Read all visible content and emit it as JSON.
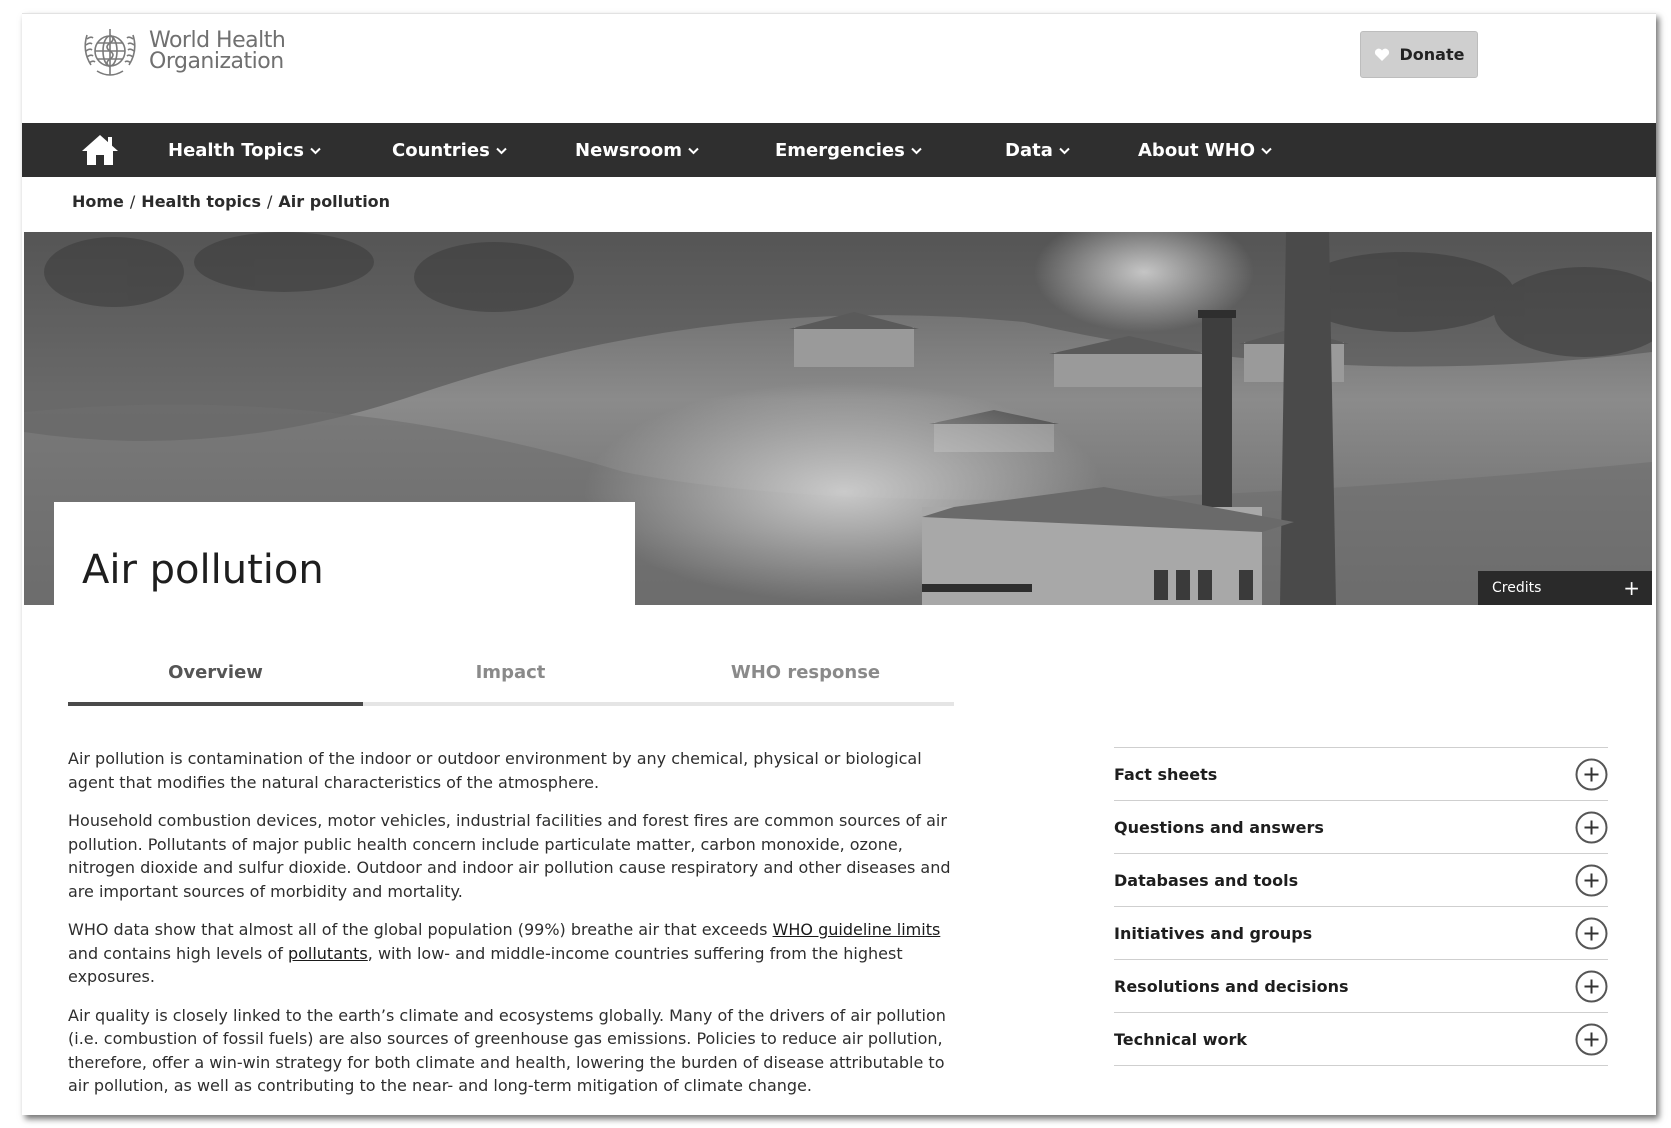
{
  "header": {
    "logo_line1": "World Health",
    "logo_line2": "Organization",
    "donate_label": "Donate"
  },
  "nav": {
    "items": [
      {
        "label": "Health Topics"
      },
      {
        "label": "Countries"
      },
      {
        "label": "Newsroom"
      },
      {
        "label": "Emergencies"
      },
      {
        "label": "Data"
      },
      {
        "label": "About WHO"
      }
    ]
  },
  "breadcrumb": {
    "items": [
      "Home",
      "Health topics",
      "Air pollution"
    ],
    "separator": "/"
  },
  "hero": {
    "title": "Air pollution",
    "credits_label": "Credits",
    "credits_icon": "+"
  },
  "tabs": [
    {
      "label": "Overview",
      "active": true
    },
    {
      "label": "Impact",
      "active": false
    },
    {
      "label": "WHO response",
      "active": false
    }
  ],
  "content": {
    "p1": "Air pollution is contamination of the indoor or outdoor environment by any chemical, physical or biological agent that modifies the natural characteristics of the atmosphere.",
    "p2": "Household combustion devices, motor vehicles, industrial facilities and forest fires are common sources of air pollution. Pollutants of major public health concern include particulate matter, carbon monoxide, ozone, nitrogen dioxide and sulfur dioxide. Outdoor and indoor air pollution cause respiratory and other diseases and are important sources of morbidity and mortality.",
    "p3_before": "WHO data show that almost all of the global population (99%) breathe air that exceeds ",
    "p3_link1": "WHO guideline limits",
    "p3_middle": " and contains high levels of ",
    "p3_link2": "pollutants",
    "p3_after": ", with low- and middle-income countries suffering from the highest exposures.",
    "p4": "Air quality is closely linked to the earth’s climate and ecosystems globally. Many of the drivers of air pollution (i.e. combustion of fossil fuels) are also sources of greenhouse gas emissions. Policies to reduce air pollution, therefore, offer a win-win strategy for both climate and health, lowering the burden of disease attributable to air pollution, as well as contributing to the near- and long-term mitigation of climate change."
  },
  "accordion": [
    {
      "label": "Fact sheets"
    },
    {
      "label": "Questions and answers"
    },
    {
      "label": "Databases and tools"
    },
    {
      "label": "Initiatives and groups"
    },
    {
      "label": "Resolutions and decisions"
    },
    {
      "label": "Technical work"
    }
  ],
  "colors": {
    "nav_bg": "#2f2f2f",
    "donate_bg": "#cfcfcf",
    "credits_bg": "#2a2a2a",
    "active_tab_underline": "#4a4a4a"
  }
}
